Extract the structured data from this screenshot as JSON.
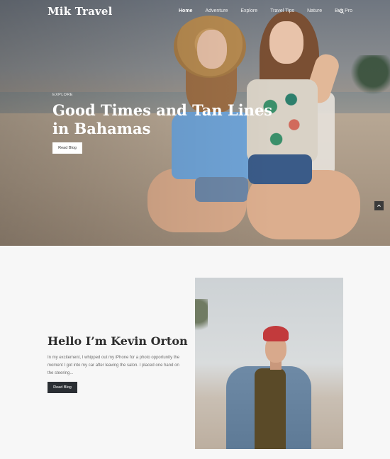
{
  "header": {
    "logo": "Mik Travel",
    "nav": [
      {
        "label": "Home",
        "active": true
      },
      {
        "label": "Adventure",
        "active": false
      },
      {
        "label": "Explore",
        "active": false
      },
      {
        "label": "Travel Tips",
        "active": false
      },
      {
        "label": "Nature",
        "active": false
      },
      {
        "label": "Buy Pro",
        "active": false
      }
    ],
    "search_icon": "search-icon"
  },
  "hero": {
    "eyebrow": "EXPLORE",
    "title_line1": "Good Times and Tan Lines",
    "title_line2": "in Bahamas",
    "button": "Read Blog"
  },
  "about": {
    "title": "Hello I’m Kevin Orton",
    "text": "In my excitement, I whipped out my iPhone for a photo opportunity the moment I got into my car after leaving the salon. I placed one hand on the steering...",
    "button": "Read Blog"
  },
  "colors": {
    "dark_button": "#2a2e33",
    "page_bg": "#f7f7f7"
  }
}
